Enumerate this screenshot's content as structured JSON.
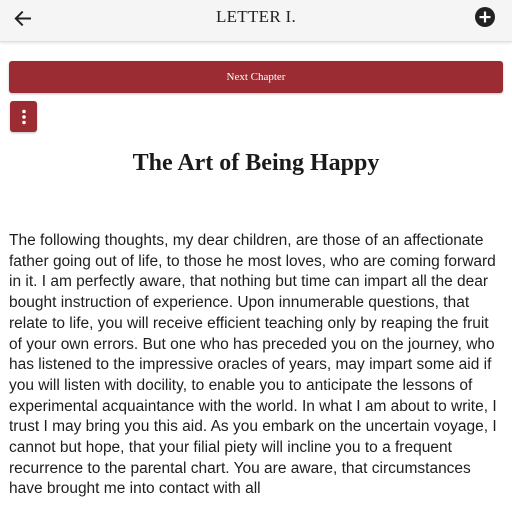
{
  "header": {
    "title": "LETTER I.",
    "back_icon": "arrow-left-icon",
    "add_icon": "plus-circle-icon"
  },
  "toolbar": {
    "next_chapter_label": "Next Chapter",
    "menu_icon": "more-vertical-icon",
    "accent_color": "#9b2c33"
  },
  "content": {
    "book_title": "The Art of Being Happy",
    "paragraph": "The following thoughts, my dear children, are those of an affectionate father going out of life, to those he most loves, who are coming forward in it. I am perfectly aware, that nothing but time can impart all the dear bought instruction of experience. Upon innumerable questions, that relate to life, you will receive efficient teaching only by reaping the fruit of your own errors. But one who has preceded you on the journey, who has listened to the impressive oracles of years, may impart some aid if you will listen with docility, to enable you to anticipate the lessons of experimental acquaintance with the world. In what I am about to write, I trust I may bring you this aid. As you embark on the uncertain voyage, I cannot but hope, that your filial piety will incline you to a frequent recurrence to the parental chart. You are aware, that circumstances have brought me into contact with all"
  }
}
